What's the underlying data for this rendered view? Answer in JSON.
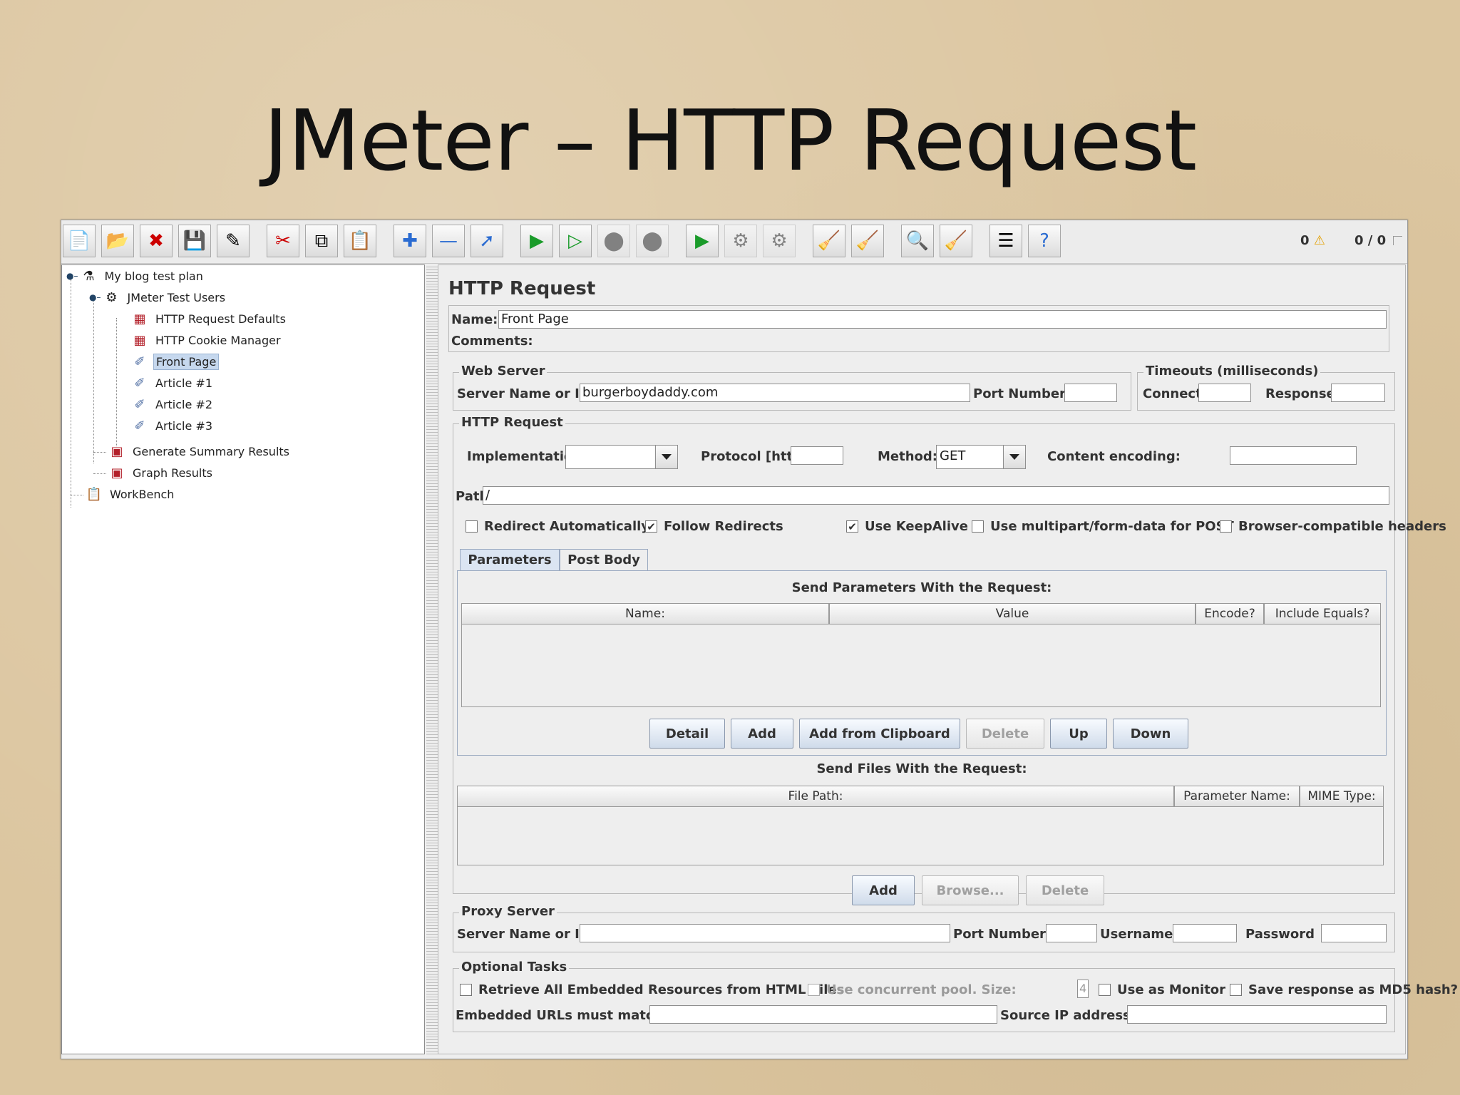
{
  "slide_title": "JMeter – HTTP Request",
  "status": {
    "warnings": "0",
    "threads": "0 / 0"
  },
  "tree": {
    "items": [
      {
        "label": "My blog test plan"
      },
      {
        "label": "JMeter Test Users"
      },
      {
        "label": "HTTP Request Defaults"
      },
      {
        "label": "HTTP Cookie Manager"
      },
      {
        "label": "Front Page"
      },
      {
        "label": "Article #1"
      },
      {
        "label": "Article #2"
      },
      {
        "label": "Article #3"
      },
      {
        "label": "Generate Summary Results"
      },
      {
        "label": "Graph Results"
      },
      {
        "label": "WorkBench"
      }
    ],
    "selected": "Front Page"
  },
  "panel": {
    "title": "HTTP Request",
    "name_label": "Name:",
    "name_value": "Front Page",
    "comments_label": "Comments:",
    "web_server": {
      "title": "Web Server",
      "server_label": "Server Name or IP:",
      "server_value": "burgerboydaddy.com",
      "port_label": "Port Number:"
    },
    "timeouts": {
      "title": "Timeouts (milliseconds)",
      "connect_label": "Connect:",
      "response_label": "Response:"
    },
    "http_request": {
      "title": "HTTP Request",
      "implementation_label": "Implementation:",
      "protocol_label": "Protocol [http]:",
      "method_label": "Method:",
      "method_value": "GET",
      "encoding_label": "Content encoding:",
      "path_label": "Path:",
      "path_value": "/",
      "checkboxes": [
        {
          "label": "Redirect Automatically",
          "checked": false
        },
        {
          "label": "Follow Redirects",
          "checked": true
        },
        {
          "label": "Use KeepAlive",
          "checked": true
        },
        {
          "label": "Use multipart/form-data for POST",
          "checked": false
        },
        {
          "label": "Browser-compatible headers",
          "checked": false
        }
      ]
    },
    "tabs": [
      "Parameters",
      "Post Body"
    ],
    "params": {
      "heading": "Send Parameters With the Request:",
      "columns": [
        "Name:",
        "Value",
        "Encode?",
        "Include Equals?"
      ],
      "buttons": [
        "Detail",
        "Add",
        "Add from Clipboard",
        "Delete",
        "Up",
        "Down"
      ]
    },
    "files": {
      "heading": "Send Files With the Request:",
      "columns": [
        "File Path:",
        "Parameter Name:",
        "MIME Type:"
      ],
      "buttons": [
        "Add",
        "Browse...",
        "Delete"
      ]
    },
    "proxy": {
      "title": "Proxy Server",
      "server_label": "Server Name or IP:",
      "port_label": "Port Number:",
      "username_label": "Username",
      "password_label": "Password"
    },
    "optional": {
      "title": "Optional Tasks",
      "retrieve_label": "Retrieve All Embedded Resources from HTML Files",
      "pool_label": "Use concurrent pool. Size:",
      "pool_value": "4",
      "monitor_label": "Use as Monitor",
      "md5_label": "Save response as MD5 hash?",
      "embedded_label": "Embedded URLs must match:",
      "source_ip_label": "Source IP address:"
    }
  }
}
